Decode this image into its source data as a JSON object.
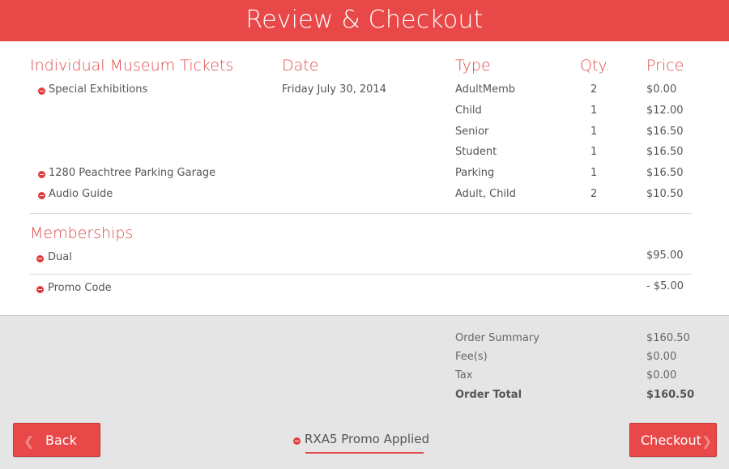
{
  "header": {
    "title": "Review & Checkout"
  },
  "columns": {
    "tickets_title": "Individual Museum Tickets",
    "date": "Date",
    "type": "Type",
    "qty": "Qty.",
    "price": "Price"
  },
  "tickets": [
    {
      "item": "Special Exhibitions",
      "date": "Friday July 30, 2014",
      "type": "AdultMemb",
      "qty": "2",
      "price": "$0.00"
    },
    {
      "item": "",
      "date": "",
      "type": "Child",
      "qty": "1",
      "price": "$12.00"
    },
    {
      "item": "",
      "date": "",
      "type": "Senior",
      "qty": "1",
      "price": "$16.50"
    },
    {
      "item": "",
      "date": "",
      "type": "Student",
      "qty": "1",
      "price": "$16.50"
    },
    {
      "item": "1280 Peachtree Parking Garage",
      "date": "",
      "type": "Parking",
      "qty": "1",
      "price": "$16.50"
    },
    {
      "item": "Audio Guide",
      "date": "",
      "type": "Adult, Child",
      "qty": "2",
      "price": "$10.50"
    }
  ],
  "memberships": {
    "title": "Memberships",
    "item": "Dual",
    "price": "$95.00"
  },
  "promo_line": {
    "label": "Promo Code",
    "price": "- $5.00"
  },
  "summary": {
    "order_summary_label": "Order Summary",
    "order_summary_value": "$160.50",
    "fees_label": "Fee(s)",
    "fees_value": "$0.00",
    "tax_label": "Tax",
    "tax_value": "$0.00",
    "total_label": "Order Total",
    "total_value": "$160.50"
  },
  "footer": {
    "back_label": "Back",
    "checkout_label": "Checkout",
    "promo_applied": "RXA5 Promo Applied"
  },
  "colors": {
    "accent": "#e84848",
    "summary_bg": "#e5e5e5"
  },
  "icons": {
    "remove": "minus-circle-icon",
    "back": "chevron-left-icon",
    "forward": "chevron-right-icon"
  }
}
